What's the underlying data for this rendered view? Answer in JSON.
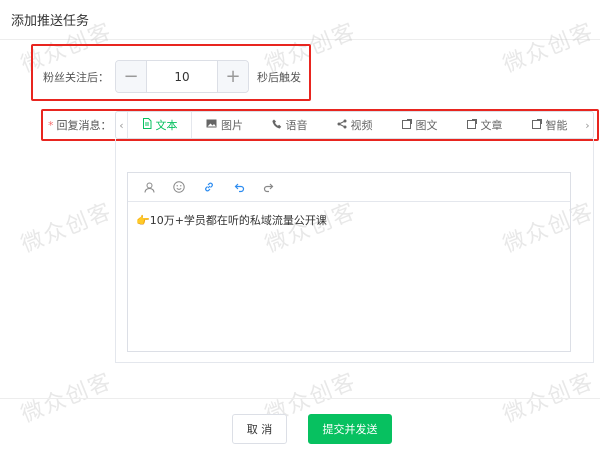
{
  "dialog": {
    "title": "添加推送任务"
  },
  "watermark": {
    "text": "微众创客"
  },
  "follow": {
    "label": "粉丝关注后：",
    "value": "10",
    "minus": "−",
    "plus": "+",
    "suffix": "秒后触发"
  },
  "reply": {
    "required_mark": "*",
    "label": "回复消息：",
    "prev_arrow": "‹",
    "next_arrow": "›",
    "tabs": [
      {
        "label": "文本",
        "icon": "document-icon",
        "active": true
      },
      {
        "label": "图片",
        "icon": "image-icon"
      },
      {
        "label": "语音",
        "icon": "phone-icon"
      },
      {
        "label": "视频",
        "icon": "share-icon"
      },
      {
        "label": "图文",
        "icon": "news-icon"
      },
      {
        "label": "文章",
        "icon": "article-icon"
      },
      {
        "label": "智能",
        "icon": "smart-icon"
      }
    ]
  },
  "editor": {
    "content": "👉10万+学员都在听的私域流量公开课",
    "tools": [
      "user-icon",
      "emoji-icon",
      "link-icon",
      "undo-icon",
      "redo-icon"
    ]
  },
  "footer": {
    "cancel_label": "取 消",
    "submit_label": "提交并发送"
  },
  "colors": {
    "accent": "#07c160",
    "highlight": "#e8251f",
    "required": "#f56c6c",
    "link": "#2d8cf0"
  }
}
